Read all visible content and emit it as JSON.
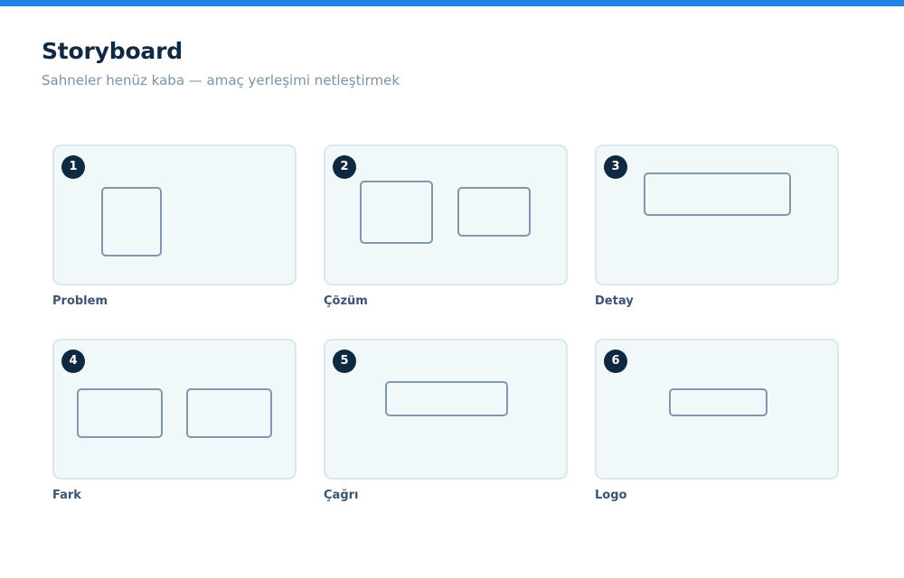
{
  "header": {
    "title": "Storyboard",
    "subtitle": "Sahneler henüz kaba — amaç yerleşimi netleştirmek"
  },
  "colors": {
    "accent_bar": "#2182e3",
    "badge": "#0f2a40",
    "frame_fill": "#f1f8f9",
    "frame_border": "#dbe7ec",
    "placeholder_stroke": "#7f98ac"
  },
  "scenes": [
    {
      "number": "1",
      "label": "Problem"
    },
    {
      "number": "2",
      "label": "Çözüm"
    },
    {
      "number": "3",
      "label": "Detay"
    },
    {
      "number": "4",
      "label": "Fark"
    },
    {
      "number": "5",
      "label": "Çağrı"
    },
    {
      "number": "6",
      "label": "Logo"
    }
  ]
}
